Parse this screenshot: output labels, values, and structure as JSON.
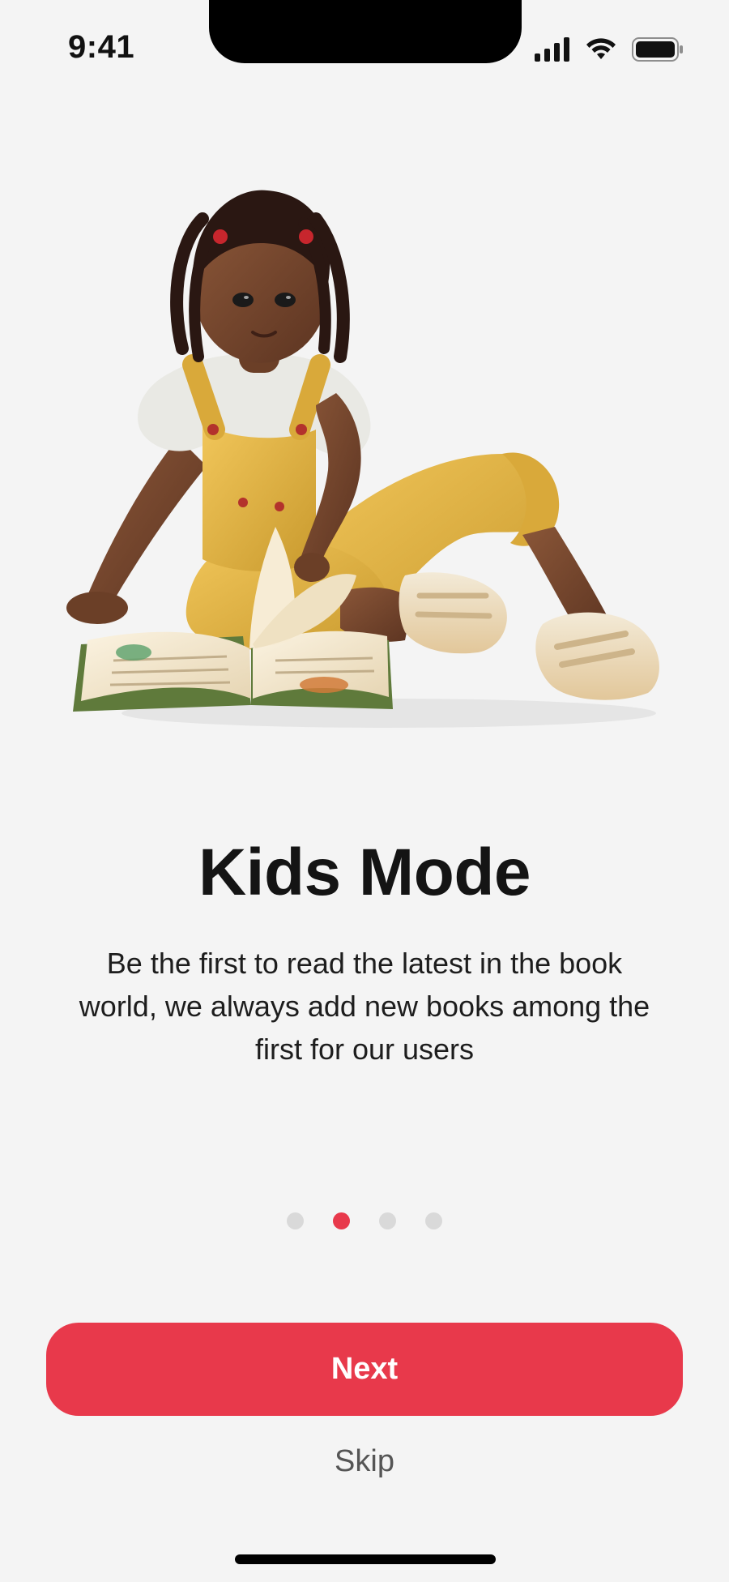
{
  "status_bar": {
    "time": "9:41",
    "icons": [
      "signal-icon",
      "wifi-icon",
      "battery-icon"
    ]
  },
  "illustration": {
    "subject": "child-reading-book-illustration"
  },
  "onboarding": {
    "title": "Kids Mode",
    "description": "Be the first to read the latest in the book world, we always add new books among the first for our users",
    "page_count": 4,
    "active_page": 2
  },
  "actions": {
    "next_label": "Next",
    "skip_label": "Skip"
  },
  "colors": {
    "accent": "#e8394b",
    "background": "#f4f4f4",
    "dot_inactive": "#d9d9d9"
  }
}
